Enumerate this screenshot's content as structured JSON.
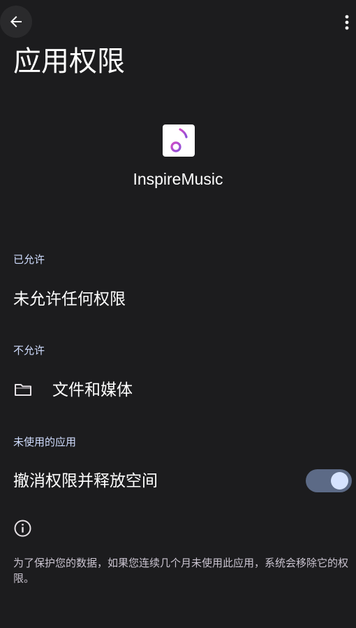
{
  "header": {
    "back_icon": "arrow-left-icon",
    "more_icon": "more-vert-icon",
    "title": "应用权限"
  },
  "app": {
    "icon": "music-note-icon",
    "name": "InspireMusic"
  },
  "sections": {
    "allowed": {
      "header": "已允许",
      "empty_text": "未允许任何权限"
    },
    "not_allowed": {
      "header": "不允许",
      "items": [
        {
          "icon": "folder-icon",
          "label": "文件和媒体"
        }
      ]
    },
    "unused_apps": {
      "header": "未使用的应用",
      "toggle_label": "撤消权限并释放空间",
      "toggle_on": true
    }
  },
  "footer": {
    "info_icon": "info-icon",
    "text": "为了保护您的数据，如果您连续几个月未使用此应用，系统会移除它的权限。"
  },
  "colors": {
    "background": "#1c1c1e",
    "section_header": "#d0ddff",
    "toggle_track": "#5c6a86",
    "toggle_thumb": "#d6e3ff",
    "icon_gradient_start": "#d04bc8",
    "icon_gradient_end": "#8a4fd8"
  }
}
